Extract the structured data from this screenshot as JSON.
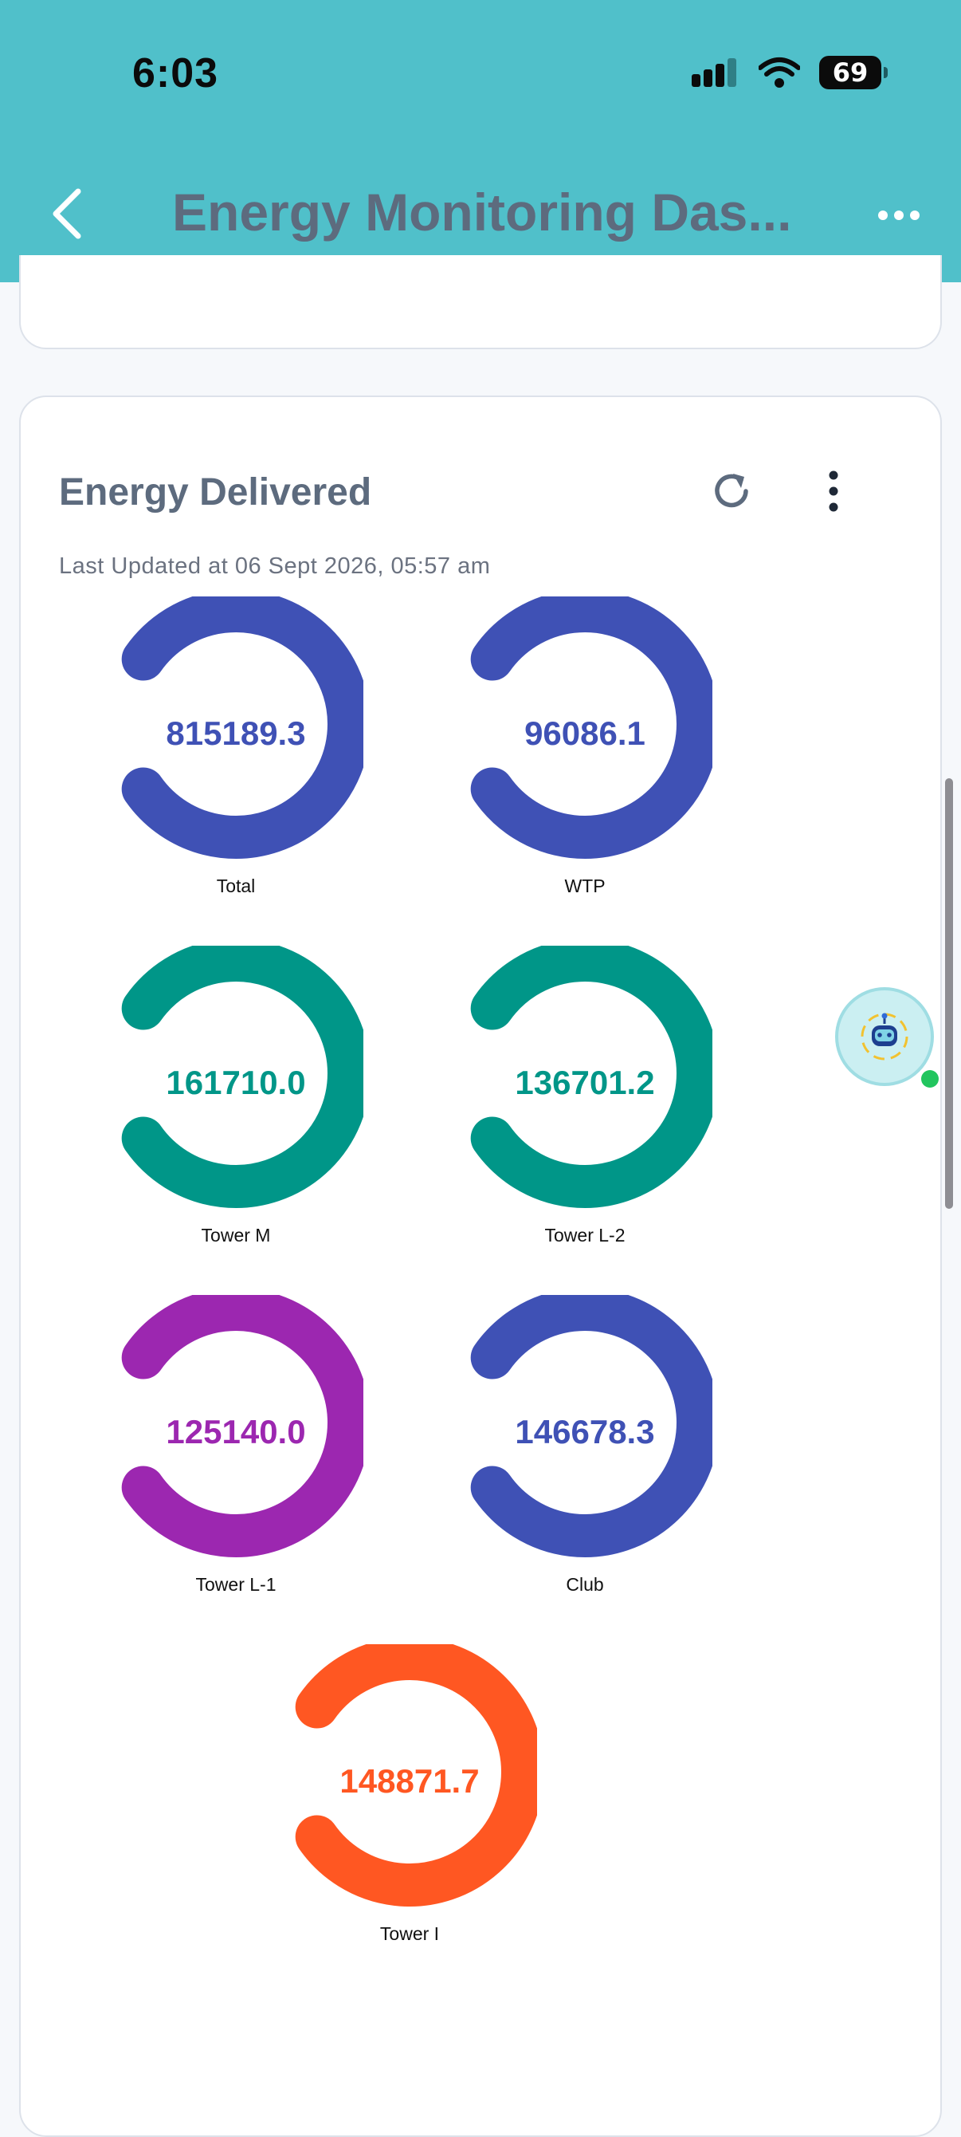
{
  "status_bar": {
    "time": "6:03",
    "battery": "69"
  },
  "header": {
    "title": "Energy Monitoring Das...",
    "background": "#50c0ca"
  },
  "widget": {
    "title": "Energy Delivered",
    "last_updated": "Last Updated at 06 Sept 2026, 05:57 am",
    "gauges": [
      {
        "label": "Total",
        "value": "815189.3",
        "color": "#3f51b5"
      },
      {
        "label": "WTP",
        "value": "96086.1",
        "color": "#3f51b5"
      },
      {
        "label": "Tower M",
        "value": "161710.0",
        "color": "#009688"
      },
      {
        "label": "Tower L-2",
        "value": "136701.2",
        "color": "#009688"
      },
      {
        "label": "Tower L-1",
        "value": "125140.0",
        "color": "#9c27b0"
      },
      {
        "label": "Club",
        "value": "146678.3",
        "color": "#3f51b5"
      },
      {
        "label": "Tower I",
        "value": "148871.7",
        "color": "#ff5722"
      }
    ]
  }
}
